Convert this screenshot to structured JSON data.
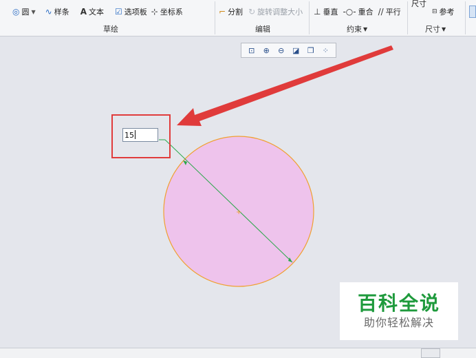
{
  "ribbon": {
    "sketch_tools": {
      "circle": "圆",
      "spline": "样条",
      "text": "文本",
      "palette": "选项板",
      "coordsys": "坐标系"
    },
    "edit_tools": {
      "divide": "分割",
      "rotate_resize": "旋转调整大小"
    },
    "constrain_tools": {
      "vertical": "垂直",
      "coincident": "重合",
      "parallel": "平行"
    },
    "dimension_tools": {
      "title": "尺寸",
      "reference": "参考"
    },
    "group_labels": {
      "sketch": "草绘",
      "edit": "编辑",
      "constrain": "约束",
      "dimension": "尺寸"
    }
  },
  "dimension_input": {
    "value": "15"
  },
  "watermark": {
    "title": "百科全说",
    "subtitle": "助你轻松解决"
  },
  "colors": {
    "circle_fill": "#eec3ec",
    "circle_stroke": "#f0a030",
    "dimension_line": "#2aa84a",
    "arrow": "#e03b3b",
    "watermark_green": "#1e9a3c"
  }
}
